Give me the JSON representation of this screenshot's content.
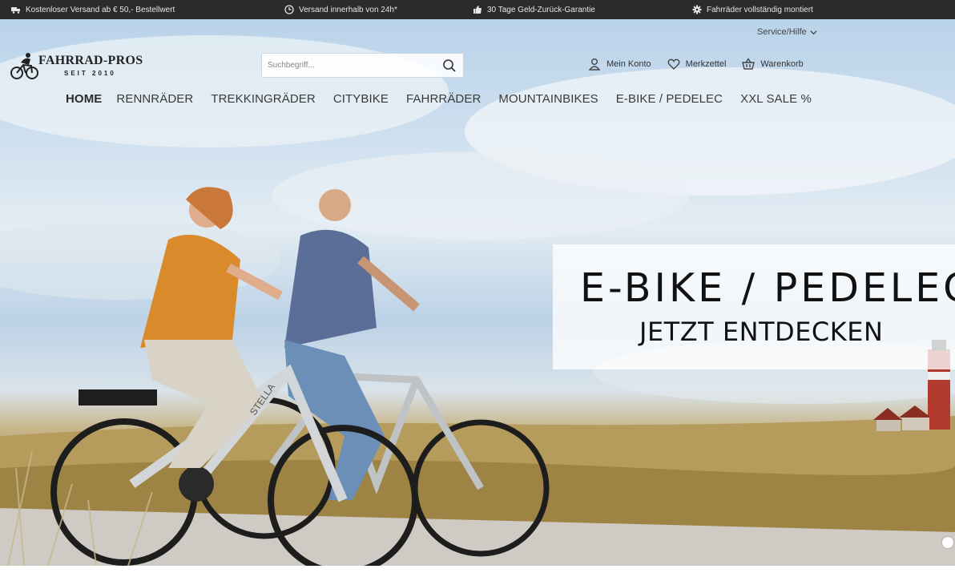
{
  "promo_bar": {
    "items": [
      {
        "icon": "truck-icon",
        "text": "Kostenloser Versand ab € 50,- Bestellwert"
      },
      {
        "icon": "clock-icon",
        "text": "Versand innerhalb von 24h*"
      },
      {
        "icon": "thumbs-up-icon",
        "text": "30 Tage Geld-Zurück-Garantie"
      },
      {
        "icon": "gear-icon",
        "text": "Fahrräder vollständig montiert"
      }
    ]
  },
  "header": {
    "service_label": "Service/Hilfe",
    "logo": {
      "name": "FAHRRAD-PROS",
      "tagline": "SEIT 2010"
    },
    "search": {
      "placeholder": "Suchbegriff..."
    },
    "account": {
      "my_account": "Mein Konto",
      "wishlist": "Merkzettel",
      "cart": "Warenkorb"
    }
  },
  "nav": {
    "items": [
      "HOME",
      "RENNRÄDER",
      "TREKKINGRÄDER",
      "CITYBIKE",
      "FAHRRÄDER",
      "MOUNTAINBIKES",
      "E-BIKE / PEDELEC",
      "XXL SALE %"
    ]
  },
  "hero": {
    "title": "E-BIKE / PEDELEC",
    "subtitle": "JETZT ENTDECKEN",
    "bike_brand": "STELLA"
  },
  "colors": {
    "promo_bg": "#2b2b2b",
    "text": "#333333"
  }
}
